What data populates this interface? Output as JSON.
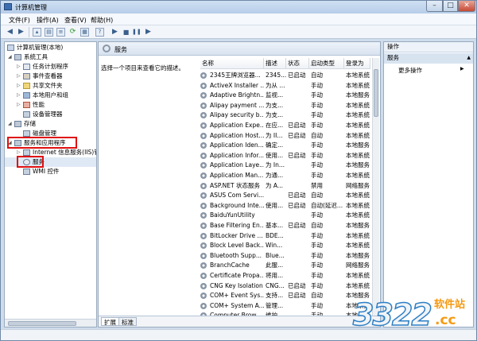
{
  "window": {
    "title": "计算机管理",
    "controls": {
      "minimize": "–",
      "maximize": "□",
      "close": "✕"
    }
  },
  "menu": [
    "文件(F)",
    "操作(A)",
    "查看(V)",
    "帮助(H)"
  ],
  "tree": {
    "root": "计算机管理(本地)",
    "system_tools": "系统工具",
    "task_scheduler": "任务计划程序",
    "event_viewer": "事件查看器",
    "shared_folders": "共享文件夹",
    "local_users": "本地用户和组",
    "performance": "性能",
    "device_manager": "设备管理器",
    "storage": "存储",
    "disk_mgmt": "磁盘管理",
    "services_apps": "服务和应用程序",
    "iis": "Internet 信息服务(IIS)管",
    "services": "服务",
    "wmi": "WMI 控件"
  },
  "center": {
    "header": "服务",
    "description": "选择一个项目来查看它的描述。",
    "columns": {
      "name": "名称",
      "desc": "描述",
      "status": "状态",
      "startup": "启动类型",
      "logon": "登录为"
    },
    "rows": [
      {
        "name": "2345王牌浏览器...",
        "desc": "2345...",
        "status": "已启动",
        "startup": "自动",
        "logon": "本地系统"
      },
      {
        "name": "ActiveX Installer ...",
        "desc": "为从 ...",
        "status": "",
        "startup": "手动",
        "logon": "本地系统"
      },
      {
        "name": "Adaptive Brightn...",
        "desc": "监视...",
        "status": "",
        "startup": "手动",
        "logon": "本地服务"
      },
      {
        "name": "Alipay payment ...",
        "desc": "为支...",
        "status": "",
        "startup": "手动",
        "logon": "本地系统"
      },
      {
        "name": "Alipay security b...",
        "desc": "为支...",
        "status": "",
        "startup": "手动",
        "logon": "本地系统"
      },
      {
        "name": "Application Expe...",
        "desc": "在应...",
        "status": "已启动",
        "startup": "手动",
        "logon": "本地系统"
      },
      {
        "name": "Application Host...",
        "desc": "为 II...",
        "status": "已启动",
        "startup": "自动",
        "logon": "本地系统"
      },
      {
        "name": "Application Iden...",
        "desc": "确定...",
        "status": "",
        "startup": "手动",
        "logon": "本地服务"
      },
      {
        "name": "Application Infor...",
        "desc": "使用...",
        "status": "已启动",
        "startup": "手动",
        "logon": "本地系统"
      },
      {
        "name": "Application Laye...",
        "desc": "为 In...",
        "status": "",
        "startup": "手动",
        "logon": "本地服务"
      },
      {
        "name": "Application Man...",
        "desc": "为通...",
        "status": "",
        "startup": "手动",
        "logon": "本地系统"
      },
      {
        "name": "ASP.NET 状态服务",
        "desc": "为 A...",
        "status": "",
        "startup": "禁用",
        "logon": "网络服务"
      },
      {
        "name": "ASUS Com Servi...",
        "desc": "",
        "status": "已启动",
        "startup": "自动",
        "logon": "本地系统"
      },
      {
        "name": "Background Inte...",
        "desc": "使用...",
        "status": "已启动",
        "startup": "自动(延迟...",
        "logon": "本地系统"
      },
      {
        "name": "BaiduYunUtility",
        "desc": "",
        "status": "",
        "startup": "手动",
        "logon": "本地系统"
      },
      {
        "name": "Base Filtering En...",
        "desc": "基本...",
        "status": "已启动",
        "startup": "自动",
        "logon": "本地服务"
      },
      {
        "name": "BitLocker Drive ...",
        "desc": "BDE...",
        "status": "",
        "startup": "手动",
        "logon": "本地系统"
      },
      {
        "name": "Block Level Back...",
        "desc": "Win...",
        "status": "",
        "startup": "手动",
        "logon": "本地系统"
      },
      {
        "name": "Bluetooth Supp...",
        "desc": "Blue...",
        "status": "",
        "startup": "手动",
        "logon": "本地服务"
      },
      {
        "name": "BranchCache",
        "desc": "此服...",
        "status": "",
        "startup": "手动",
        "logon": "网络服务"
      },
      {
        "name": "Certificate Propa...",
        "desc": "将用...",
        "status": "",
        "startup": "手动",
        "logon": "本地系统"
      },
      {
        "name": "CNG Key Isolation",
        "desc": "CNG...",
        "status": "已启动",
        "startup": "手动",
        "logon": "本地系统"
      },
      {
        "name": "COM+ Event Sys...",
        "desc": "支持...",
        "status": "已启动",
        "startup": "自动",
        "logon": "本地服务"
      },
      {
        "name": "COM+ System A...",
        "desc": "管理...",
        "status": "",
        "startup": "手动",
        "logon": "本地系统"
      },
      {
        "name": "Computer Brow...",
        "desc": "维护...",
        "status": "",
        "startup": "手动",
        "logon": "本地系统"
      }
    ]
  },
  "tabs": {
    "extended": "扩展",
    "standard": "标准"
  },
  "actions": {
    "header": "操作",
    "section": "服务",
    "more": "更多操作"
  },
  "watermark": {
    "number": "3322",
    "cn": "软件站",
    "domain": ".cc"
  }
}
